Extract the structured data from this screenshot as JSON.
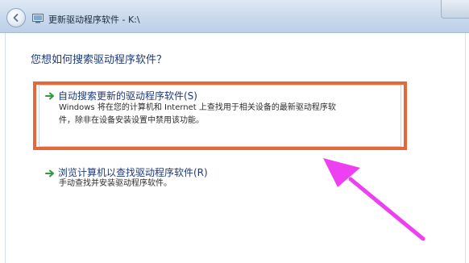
{
  "window": {
    "title": "更新驱动程序软件 - K:\\"
  },
  "dialog": {
    "question": "您想如何搜索驱动程序软件？",
    "options": [
      {
        "title": "自动搜索更新的驱动程序软件(S)",
        "description_line1": "Windows 将在您的计算机和 Internet 上查找用于相关设备的最新驱动程序软",
        "description_line2": "件，除非在设备安装设置中禁用该功能。",
        "icon": "green-arrow-icon",
        "highlighted": true
      },
      {
        "title": "浏览计算机以查找驱动程序软件(R)",
        "description_line1": "手动查找并安装驱动程序软件。",
        "icon": "green-arrow-icon",
        "highlighted": false
      }
    ]
  },
  "colors": {
    "link_blue": "#1e3a7b",
    "highlight_orange": "#e8673a",
    "pointer_magenta": "#ee3ff0",
    "arrow_green": "#2e9a3a"
  }
}
